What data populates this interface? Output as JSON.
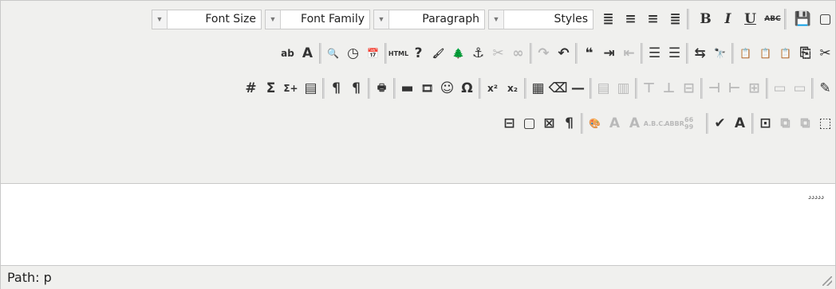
{
  "toolbar": {
    "row1": {
      "selects": {
        "font_size": "Font Size",
        "font_family": "Font Family",
        "paragraph": "Paragraph",
        "styles": "Styles"
      },
      "align_buttons": [
        {
          "name": "justify-left",
          "glyph": "≣"
        },
        {
          "name": "align-center",
          "glyph": "≡"
        },
        {
          "name": "align-right",
          "glyph": "≡"
        },
        {
          "name": "justify-full",
          "glyph": "≣"
        }
      ],
      "format_buttons": [
        {
          "name": "strikethrough",
          "glyph": "ABC"
        },
        {
          "name": "underline",
          "glyph": "U"
        },
        {
          "name": "italic",
          "glyph": "I"
        },
        {
          "name": "bold",
          "glyph": "B"
        }
      ],
      "doc_buttons": [
        {
          "name": "new-document",
          "glyph": "▢"
        },
        {
          "name": "save",
          "glyph": "💾"
        }
      ]
    },
    "row2": {
      "buttons": [
        {
          "name": "highlight-color",
          "glyph": "ab",
          "dim": false
        },
        {
          "name": "font-color",
          "glyph": "A",
          "dim": false
        },
        {
          "name": "preview",
          "glyph": "🔍",
          "dim": false
        },
        {
          "name": "insert-time",
          "glyph": "◷",
          "dim": false
        },
        {
          "name": "insert-date",
          "glyph": "📅",
          "dim": false
        },
        {
          "name": "html-source",
          "glyph": "HTML",
          "dim": false
        },
        {
          "name": "help",
          "glyph": "?",
          "dim": false
        },
        {
          "name": "cleanup",
          "glyph": "🖌",
          "dim": false
        },
        {
          "name": "insert-image",
          "glyph": "🌲",
          "dim": false
        },
        {
          "name": "anchor",
          "glyph": "⚓",
          "dim": false
        },
        {
          "name": "unlink",
          "glyph": "✂",
          "dim": true
        },
        {
          "name": "link",
          "glyph": "∞",
          "dim": true
        },
        {
          "name": "redo",
          "glyph": "↷",
          "dim": true
        },
        {
          "name": "undo",
          "glyph": "↶",
          "dim": false
        },
        {
          "name": "blockquote",
          "glyph": "❝",
          "dim": false
        },
        {
          "name": "indent",
          "glyph": "⇥",
          "dim": false
        },
        {
          "name": "outdent",
          "glyph": "⇤",
          "dim": true
        },
        {
          "name": "numbered-list",
          "glyph": "☰",
          "dim": false
        },
        {
          "name": "bullet-list",
          "glyph": "☰",
          "dim": false
        },
        {
          "name": "replace",
          "glyph": "⇆",
          "dim": false
        },
        {
          "name": "find",
          "glyph": "🔭",
          "dim": false
        },
        {
          "name": "paste-word",
          "glyph": "📋",
          "dim": false
        },
        {
          "name": "paste-text",
          "glyph": "📋",
          "dim": false
        },
        {
          "name": "paste",
          "glyph": "📋",
          "dim": false
        },
        {
          "name": "copy",
          "glyph": "⎘",
          "dim": false
        },
        {
          "name": "cut",
          "glyph": "✂",
          "dim": false
        }
      ]
    },
    "row3": {
      "buttons": [
        {
          "name": "visual-aid",
          "glyph": "#",
          "dim": false
        },
        {
          "name": "math-sum",
          "glyph": "Σ",
          "dim": false
        },
        {
          "name": "math-sum-plus",
          "glyph": "Σ+",
          "dim": false
        },
        {
          "name": "media-box",
          "glyph": "▤",
          "dim": false
        },
        {
          "name": "ltr",
          "glyph": "¶",
          "dim": false
        },
        {
          "name": "rtl",
          "glyph": "¶",
          "dim": false
        },
        {
          "name": "print",
          "glyph": "🖶",
          "dim": false
        },
        {
          "name": "horizontal-rule-blue",
          "glyph": "▬",
          "dim": false
        },
        {
          "name": "media",
          "glyph": "🎞",
          "dim": false
        },
        {
          "name": "emoticons",
          "glyph": "☺",
          "dim": false
        },
        {
          "name": "special-char",
          "glyph": "Ω",
          "dim": false
        },
        {
          "name": "superscript",
          "glyph": "x²",
          "dim": false
        },
        {
          "name": "subscript",
          "glyph": "x₂",
          "dim": false
        },
        {
          "name": "insert-table",
          "glyph": "▦",
          "dim": false
        },
        {
          "name": "remove-format",
          "glyph": "⌫",
          "dim": false
        },
        {
          "name": "horizontal-rule",
          "glyph": "—",
          "dim": false
        },
        {
          "name": "table-row-props",
          "glyph": "▤",
          "dim": true
        },
        {
          "name": "table-cell-props",
          "glyph": "▥",
          "dim": true
        },
        {
          "name": "row-before",
          "glyph": "⊤",
          "dim": true
        },
        {
          "name": "row-after",
          "glyph": "⊥",
          "dim": true
        },
        {
          "name": "delete-row",
          "glyph": "⊟",
          "dim": true
        },
        {
          "name": "col-before",
          "glyph": "⊣",
          "dim": true
        },
        {
          "name": "col-after",
          "glyph": "⊢",
          "dim": true
        },
        {
          "name": "delete-col",
          "glyph": "⊞",
          "dim": true
        },
        {
          "name": "split-cells",
          "glyph": "▭",
          "dim": true
        },
        {
          "name": "merge-cells",
          "glyph": "▭",
          "dim": true
        },
        {
          "name": "edit-note",
          "glyph": "✎",
          "dim": false
        }
      ]
    },
    "row4": {
      "buttons": [
        {
          "name": "page-break",
          "glyph": "⊟",
          "dim": false
        },
        {
          "name": "template",
          "glyph": "▢",
          "dim": false
        },
        {
          "name": "nonbreaking",
          "glyph": "⊠",
          "dim": false
        },
        {
          "name": "show-blocks",
          "glyph": "¶",
          "dim": false
        },
        {
          "name": "style-props",
          "glyph": "🎨",
          "dim": false
        },
        {
          "name": "cite",
          "glyph": "A",
          "dim": true
        },
        {
          "name": "del",
          "glyph": "A",
          "dim": true
        },
        {
          "name": "abbr",
          "glyph": "A.B.C.",
          "dim": true
        },
        {
          "name": "acronym",
          "glyph": "ABBR",
          "dim": true
        },
        {
          "name": "ins",
          "glyph": "66 99",
          "dim": true
        },
        {
          "name": "spellcheck",
          "glyph": "✔",
          "dim": false
        },
        {
          "name": "attribs",
          "glyph": "A",
          "dim": false
        },
        {
          "name": "insert-layer",
          "glyph": "⊡",
          "dim": false
        },
        {
          "name": "move-forward",
          "glyph": "⧉",
          "dim": true
        },
        {
          "name": "move-backward",
          "glyph": "⧉",
          "dim": true
        },
        {
          "name": "absolute",
          "glyph": "⬚",
          "dim": false
        }
      ]
    }
  },
  "content": {
    "text": "ددددد"
  },
  "statusbar": {
    "path": "Path: p"
  }
}
